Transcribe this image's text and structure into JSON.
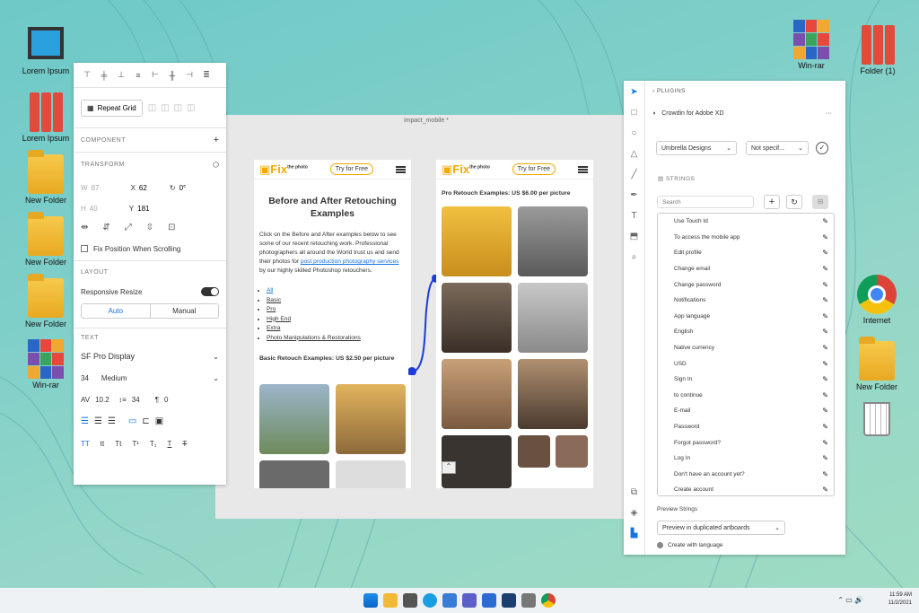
{
  "desktop": {
    "icons_left": [
      "Lorem Ipsum",
      "Lorem Ipsum",
      "New Folder",
      "New Folder",
      "New Folder",
      "Win-rar"
    ],
    "icons_right": [
      "Win-rar",
      "Folder (1)",
      "Internet",
      "New Folder"
    ]
  },
  "props": {
    "repeat_grid": "Repeat Grid",
    "component": "COMPONENT",
    "transform": "TRANSFORM",
    "w_label": "W",
    "w": "87",
    "x_label": "X",
    "x": "62",
    "rot": "0°",
    "h_label": "H",
    "h": "40",
    "y_label": "Y",
    "y": "181",
    "fix_pos": "Fix Position When Scrolling",
    "layout": "LAYOUT",
    "resize": "Responsive Resize",
    "auto": "Auto",
    "manual": "Manual",
    "text": "TEXT",
    "font": "SF Pro Display",
    "size": "34",
    "weight": "Medium",
    "spacing": "10.2",
    "line": "34",
    "para": "0",
    "case": [
      "TT",
      "tt",
      "Tt",
      "T¹",
      "T₁",
      "T",
      "T"
    ]
  },
  "canvas": {
    "doc": "impact_mobile *"
  },
  "art1": {
    "logo": "Fix",
    "logo_sub": "the photo",
    "try": "Try for Free",
    "title": "Before and After Retouching Examples",
    "body1": "Click on the Before and After examples below to see some of our recent retouching work. Professional photographers all around the World trust us and send their photos for",
    "link": "post production photography services",
    "body2": "by our highly skilled Photoshop retouchers.",
    "links": [
      "All",
      "Basic",
      "Pro",
      "High End",
      "Extra",
      "Photo Manipulations & Restorations"
    ],
    "sub": "Basic Retouch Examples: US $2.50 per picture"
  },
  "art2": {
    "logo": "Fix",
    "logo_sub": "the photo",
    "try": "Try for Free",
    "sub": "Pro Retouch Examples: US $6.00 per picture"
  },
  "plugin": {
    "back": "PLUGINS",
    "name": "Crowdin for Adobe XD",
    "more": "···",
    "project": "Umbrella Designs",
    "lang": "Not specif...",
    "strings": "STRINGS",
    "search": "Search",
    "items": [
      "Use Touch Id",
      "To access the mobile app",
      "Edit profile",
      "Change email",
      "Change password",
      "Notifications",
      "App language",
      "English",
      "Native currency",
      "USD",
      "Sign In",
      "to continue",
      "E-mail",
      "Password",
      "Forgot password?",
      "Log In",
      "Don't have an account yet?",
      "Create account"
    ],
    "preview_label": "Preview Strings",
    "preview": "Preview in duplicated artboards",
    "create": "Create with language"
  },
  "taskbar": {
    "time": "11:59 AM",
    "date": "11/2/2021"
  }
}
